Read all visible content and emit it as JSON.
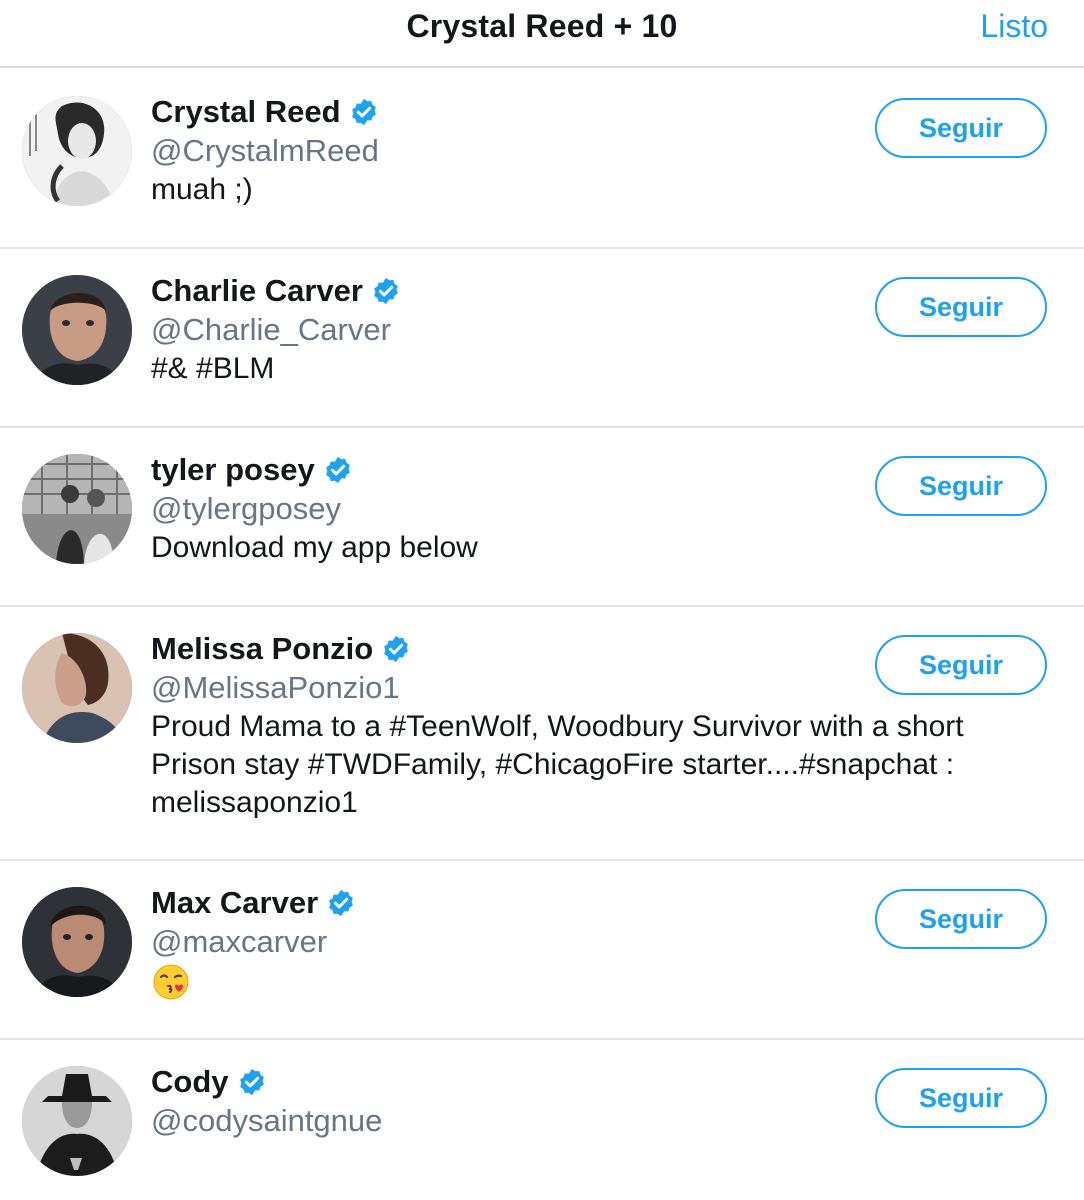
{
  "header": {
    "title": "Crystal Reed + 10",
    "done_label": "Listo"
  },
  "colors": {
    "accent": "#1da1f2",
    "handle": "#657786",
    "text": "#14171a"
  },
  "users": [
    {
      "name": "Crystal Reed",
      "handle": "@CrystalmReed",
      "bio": "muah ;)",
      "verified": true,
      "button": "Seguir"
    },
    {
      "name": "Charlie Carver",
      "handle": "@Charlie_Carver",
      "bio": "#& #BLM",
      "verified": true,
      "button": "Seguir"
    },
    {
      "name": "tyler posey",
      "handle": "@tylergposey",
      "bio": "Download my app below",
      "verified": true,
      "button": "Seguir"
    },
    {
      "name": "Melissa Ponzio",
      "handle": "@MelissaPonzio1",
      "bio": "Proud Mama to a #TeenWolf, Woodbury Survivor with a short Prison stay #TWDFamily, #ChicagoFire starter....#snapchat : melissaponzio1",
      "verified": true,
      "button": "Seguir"
    },
    {
      "name": "Max Carver",
      "handle": "@maxcarver",
      "bio_icon": "kissing-face-emoji",
      "verified": true,
      "button": "Seguir"
    },
    {
      "name": "Cody",
      "handle": "@codysaintgnue",
      "verified": true,
      "button": "Seguir"
    }
  ]
}
